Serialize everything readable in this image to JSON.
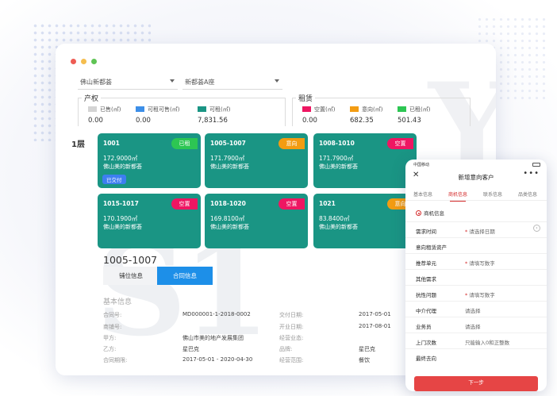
{
  "filters": {
    "project": "佛山新都荟",
    "building": "新都荟A座"
  },
  "property": {
    "title": "产权",
    "items": [
      {
        "label": "已售(㎡)",
        "value": "0.00",
        "color": "#d4d4d4"
      },
      {
        "label": "可租可售(㎡)",
        "value": "0.00",
        "color": "#3d8fe8"
      },
      {
        "label": "可租(㎡)",
        "value": "7,831.56",
        "color": "#1a9584"
      }
    ]
  },
  "lease": {
    "title": "租赁",
    "items": [
      {
        "label": "空置(㎡)",
        "value": "0.00",
        "color": "#ee1662"
      },
      {
        "label": "意向(㎡)",
        "value": "682.35",
        "color": "#f39c12"
      },
      {
        "label": "已租(㎡)",
        "value": "501.43",
        "color": "#2dc653"
      }
    ]
  },
  "floor_label": "1层",
  "units": [
    {
      "code": "1001",
      "area": "172.9000㎡",
      "project": "佛山美的新都荟",
      "status": "已租",
      "status_color": "#2dc653",
      "chip": "已交付"
    },
    {
      "code": "1005-1007",
      "area": "171.7900㎡",
      "project": "佛山美的新都荟",
      "status": "意向",
      "status_color": "#f39c12"
    },
    {
      "code": "1008-1010",
      "area": "171.7900㎡",
      "project": "佛山美的新都荟",
      "status": "空置",
      "status_color": "#ee1662"
    },
    {
      "code": "1015-1017",
      "area": "170.1900㎡",
      "project": "佛山美的新都荟",
      "status": "空置",
      "status_color": "#ee1662"
    },
    {
      "code": "1018-1020",
      "area": "169.8100㎡",
      "project": "佛山美的新都荟",
      "status": "空置",
      "status_color": "#ee1662"
    },
    {
      "code": "1021",
      "area": "83.8400㎡",
      "project": "佛山美的新都荟",
      "status": "意向",
      "status_color": "#f39c12"
    }
  ],
  "detail": {
    "title": "1005-1007",
    "tabs": [
      "铺位信息",
      "合同信息"
    ],
    "section": "基本信息",
    "left": [
      {
        "k": "合同号:",
        "v": "MD000001-1-2018-0002"
      },
      {
        "k": "商铺号:",
        "v": ""
      },
      {
        "k": "甲方:",
        "v": "佛山市美的地产发展集团"
      },
      {
        "k": "乙方:",
        "v": "星巴克"
      },
      {
        "k": "合同期限:",
        "v": "2017-05-01 - 2020-04-30"
      }
    ],
    "right": [
      {
        "k": "交付日期:",
        "v": "2017-05-01"
      },
      {
        "k": "开业日期:",
        "v": "2017-08-01"
      },
      {
        "k": "经营业态:",
        "v": ""
      },
      {
        "k": "品牌:",
        "v": "星巴克"
      },
      {
        "k": "经营范围:",
        "v": "餐饮"
      }
    ]
  },
  "phone": {
    "carrier": "中国移动",
    "title": "新增意向客户",
    "close": "✕",
    "more": "•••",
    "tabs": [
      "基本信息",
      "商机信息",
      "联系信息",
      "品类信息"
    ],
    "radio": "商机信息",
    "rows": [
      {
        "label": "需求时间",
        "value": "请选择日期",
        "required": true,
        "chev": true
      },
      {
        "label": "意向租赁资产",
        "value": ""
      },
      {
        "label": "推荐单元",
        "value": "请填写数字",
        "required": true
      },
      {
        "label": "其他需求",
        "value": ""
      },
      {
        "label": "抗性问题",
        "value": "请填写数字",
        "required": true
      },
      {
        "label": "中介代理",
        "value": "请选择"
      },
      {
        "label": "业务员",
        "value": "请选择"
      },
      {
        "label": "上门次数",
        "value": "只能输入0和正整数"
      },
      {
        "label": "最终去向",
        "value": ""
      }
    ],
    "button": "下一步"
  }
}
